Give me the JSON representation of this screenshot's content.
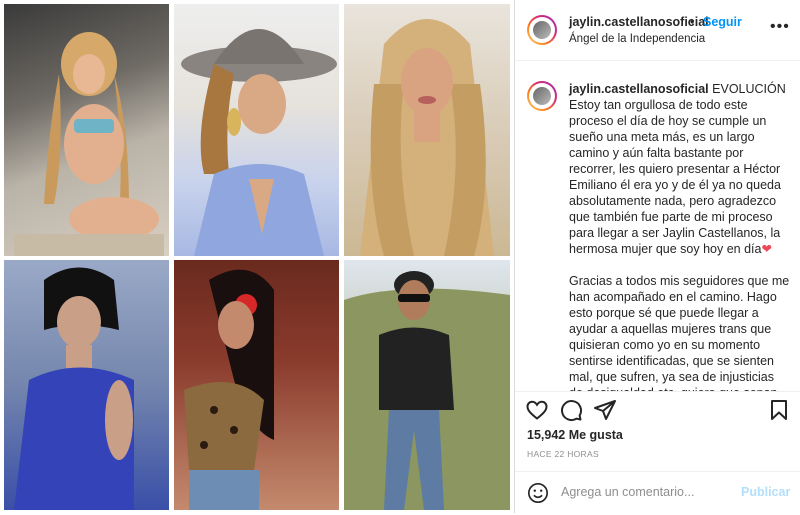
{
  "post": {
    "username": "jaylin.castellanosoficial",
    "dot": "•",
    "follow_label": "Seguir",
    "location": "Ángel de la Independencia",
    "more_label": "•••",
    "caption": {
      "username": "jaylin.castellanosoficial",
      "paragraph1": "EVOLUCIÓN Estoy tan orgullosa de todo este proceso el día de hoy se cumple un sueño una meta más, es un largo camino y aún falta bastante por recorrer, les quiero presentar a Héctor Emiliano él era yo y de él ya no queda absolutamente nada, pero agradezco que también fue parte de mi proceso para llegar a ser Jaylin Castellanos, la hermosa mujer que soy hoy en día",
      "heart": "❤",
      "paragraph2": "Gracias a todos mis seguidores que me han acompañado en el camino. Hago esto porque sé que puede llegar a ayudar a aquellas mujeres trans que quisieran como yo en su momento sentirse identificadas, que se sienten mal, que sufren, ya sea de injusticias de desigualdad etc. quiero que sepan"
    },
    "likes": "15,942 Me gusta",
    "time_ago": "HACE 22 HORAS",
    "comment_placeholder": "Agrega un comentario...",
    "publish_label": "Publicar"
  },
  "colors": {
    "link_blue": "#0095f6",
    "publish_disabled": "#b2dffc",
    "heart_red": "#ed4956",
    "muted": "#8e8e8e"
  },
  "icons": [
    "heart-icon",
    "comment-icon",
    "share-icon",
    "bookmark-icon",
    "emoji-icon",
    "more-icon"
  ]
}
